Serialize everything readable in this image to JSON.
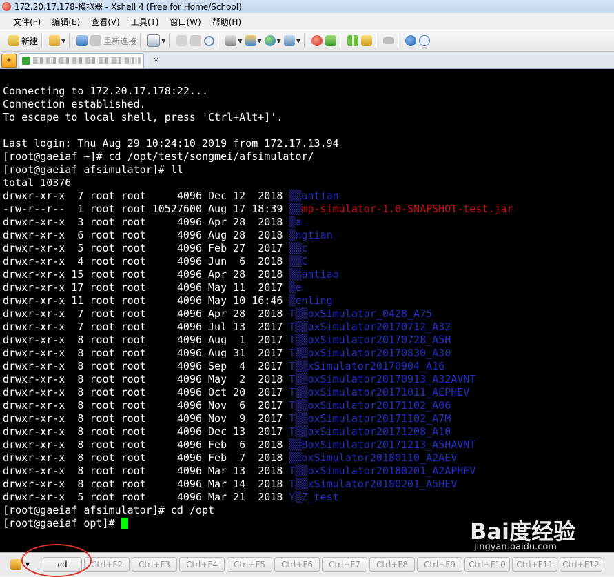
{
  "window": {
    "title": "172.20.17.178-模拟器 - Xshell 4 (Free for Home/School)"
  },
  "menu": [
    "文件(F)",
    "编辑(E)",
    "查看(V)",
    "工具(T)",
    "窗口(W)",
    "帮助(H)"
  ],
  "toolbar": {
    "new_label": "新建",
    "reconnect_label": "重新连接"
  },
  "tab": {
    "close": "×"
  },
  "terminal": {
    "lines": [
      {
        "parts": [
          {
            "t": ""
          }
        ]
      },
      {
        "parts": [
          {
            "t": "Connecting to 172.20.17.178:22..."
          }
        ]
      },
      {
        "parts": [
          {
            "t": "Connection established."
          }
        ]
      },
      {
        "parts": [
          {
            "t": "To escape to local shell, press 'Ctrl+Alt+]'."
          }
        ]
      },
      {
        "parts": [
          {
            "t": ""
          }
        ]
      },
      {
        "parts": [
          {
            "t": "Last login: Thu Aug 29 10:24:10 2019 from 172.17.13.94"
          }
        ]
      },
      {
        "parts": [
          {
            "t": "[root@gaeiaf ~]# cd /opt/test/songmei/afsimulator/"
          }
        ]
      },
      {
        "parts": [
          {
            "t": "[root@gaeiaf afsimulator]# ll"
          }
        ]
      },
      {
        "parts": [
          {
            "t": "total 10376"
          }
        ]
      },
      {
        "parts": [
          {
            "t": "drwxr-xr-x  7 root root     4096 Dec 12  2018 "
          },
          {
            "t": "▒▒",
            "c": "mask"
          },
          {
            "t": "antian",
            "c": "dir"
          }
        ]
      },
      {
        "parts": [
          {
            "t": "-rw-r--r--  1 root root 10527600 Aug 17 18:39 "
          },
          {
            "t": "▒▒",
            "c": "mask"
          },
          {
            "t": "mp-simulator-1.0-SNAPSHOT-test.jar",
            "c": "jar"
          }
        ]
      },
      {
        "parts": [
          {
            "t": "drwxr-xr-x  3 root root     4096 Apr 28  2018 "
          },
          {
            "t": "▒",
            "c": "mask"
          },
          {
            "t": "a",
            "c": "dir"
          }
        ]
      },
      {
        "parts": [
          {
            "t": "drwxr-xr-x  6 root root     4096 Aug 28  2018 "
          },
          {
            "t": "▒",
            "c": "mask"
          },
          {
            "t": "ngtian",
            "c": "dir"
          }
        ]
      },
      {
        "parts": [
          {
            "t": "drwxr-xr-x  5 root root     4096 Feb 27  2017 "
          },
          {
            "t": "▒▒",
            "c": "mask"
          },
          {
            "t": "c",
            "c": "dir"
          }
        ]
      },
      {
        "parts": [
          {
            "t": "drwxr-xr-x  4 root root     4096 Jun  6  2018 "
          },
          {
            "t": "▒▒",
            "c": "mask"
          },
          {
            "t": "C",
            "c": "dir"
          }
        ]
      },
      {
        "parts": [
          {
            "t": "drwxr-xr-x 15 root root     4096 Apr 28  2018 "
          },
          {
            "t": "▒▒",
            "c": "mask"
          },
          {
            "t": "antiao",
            "c": "dir"
          }
        ]
      },
      {
        "parts": [
          {
            "t": "drwxr-xr-x 17 root root     4096 May 11  2017 "
          },
          {
            "t": "▒",
            "c": "mask"
          },
          {
            "t": "e",
            "c": "dir"
          }
        ]
      },
      {
        "parts": [
          {
            "t": "drwxr-xr-x 11 root root     4096 May 10 16:46 "
          },
          {
            "t": "▒",
            "c": "mask"
          },
          {
            "t": "enling",
            "c": "dir"
          }
        ]
      },
      {
        "parts": [
          {
            "t": "drwxr-xr-x  7 root root     4096 Apr 28  2018 "
          },
          {
            "t": "T▒▒",
            "c": "mask"
          },
          {
            "t": "oxSimulator_0428_A75",
            "c": "dir"
          }
        ]
      },
      {
        "parts": [
          {
            "t": "drwxr-xr-x  7 root root     4096 Jul 13  2017 "
          },
          {
            "t": "T▒▒",
            "c": "mask"
          },
          {
            "t": "oxSimulator20170712_A32",
            "c": "dir"
          }
        ]
      },
      {
        "parts": [
          {
            "t": "drwxr-xr-x  8 root root     4096 Aug  1  2017 "
          },
          {
            "t": "T▒▒",
            "c": "mask"
          },
          {
            "t": "oxSimulator20170728_A5H",
            "c": "dir"
          }
        ]
      },
      {
        "parts": [
          {
            "t": "drwxr-xr-x  8 root root     4096 Aug 31  2017 "
          },
          {
            "t": "T▒▒",
            "c": "mask"
          },
          {
            "t": "oxSimulator20170830_A30",
            "c": "dir"
          }
        ]
      },
      {
        "parts": [
          {
            "t": "drwxr-xr-x  8 root root     4096 Sep  4  2017 "
          },
          {
            "t": "T▒▒",
            "c": "mask"
          },
          {
            "t": "xSimulator20170904_A16",
            "c": "dir"
          }
        ]
      },
      {
        "parts": [
          {
            "t": "drwxr-xr-x  8 root root     4096 May  2  2018 "
          },
          {
            "t": "T▒▒",
            "c": "mask"
          },
          {
            "t": "oxSimulator20170913_A32AVNT",
            "c": "dir"
          }
        ]
      },
      {
        "parts": [
          {
            "t": "drwxr-xr-x  8 root root     4096 Oct 20  2017 "
          },
          {
            "t": "T▒▒",
            "c": "mask"
          },
          {
            "t": "oxSimulator20171011_AEPHEV",
            "c": "dir"
          }
        ]
      },
      {
        "parts": [
          {
            "t": "drwxr-xr-x  8 root root     4096 Nov  6  2017 "
          },
          {
            "t": "T▒▒",
            "c": "mask"
          },
          {
            "t": "oxSimulator20171102_A06",
            "c": "dir"
          }
        ]
      },
      {
        "parts": [
          {
            "t": "drwxr-xr-x  8 root root     4096 Nov  9  2017 "
          },
          {
            "t": "T▒▒",
            "c": "mask"
          },
          {
            "t": "oxSimulator20171102_A7M",
            "c": "dir"
          }
        ]
      },
      {
        "parts": [
          {
            "t": "drwxr-xr-x  8 root root     4096 Dec 13  2017 "
          },
          {
            "t": "T▒▒",
            "c": "mask"
          },
          {
            "t": "oxSimulator20171208_A10",
            "c": "dir"
          }
        ]
      },
      {
        "parts": [
          {
            "t": "drwxr-xr-x  8 root root     4096 Feb  6  2018 "
          },
          {
            "t": "▒▒",
            "c": "mask"
          },
          {
            "t": "BoxSimulator20171213_A5HAVNT",
            "c": "dir"
          }
        ]
      },
      {
        "parts": [
          {
            "t": "drwxr-xr-x  8 root root     4096 Feb  7  2018 "
          },
          {
            "t": "▒▒",
            "c": "mask"
          },
          {
            "t": "oxSimulator20180110_A2AEV",
            "c": "dir"
          }
        ]
      },
      {
        "parts": [
          {
            "t": "drwxr-xr-x  8 root root     4096 Mar 13  2018 "
          },
          {
            "t": "T▒▒",
            "c": "mask"
          },
          {
            "t": "oxSimulator20180201_A2APHEV",
            "c": "dir"
          }
        ]
      },
      {
        "parts": [
          {
            "t": "drwxr-xr-x  8 root root     4096 Mar 14  2018 "
          },
          {
            "t": "T▒▒",
            "c": "mask"
          },
          {
            "t": "xSimulator20180201_A5HEV",
            "c": "dir"
          }
        ]
      },
      {
        "parts": [
          {
            "t": "drwxr-xr-x  5 root root     4096 Mar 21  2018 "
          },
          {
            "t": "Y▒",
            "c": "mask"
          },
          {
            "t": "Z_test",
            "c": "dir"
          }
        ]
      },
      {
        "parts": [
          {
            "t": "[root@gaeiaf afsimulator]# cd /opt"
          }
        ]
      },
      {
        "parts": [
          {
            "t": "[root@gaeiaf opt]# "
          }
        ],
        "cursor": true
      }
    ]
  },
  "quickbar": {
    "buttons": [
      {
        "label": "cd",
        "active": true
      },
      {
        "label": "Ctrl+F2"
      },
      {
        "label": "Ctrl+F3"
      },
      {
        "label": "Ctrl+F4"
      },
      {
        "label": "Ctrl+F5"
      },
      {
        "label": "Ctrl+F6"
      },
      {
        "label": "Ctrl+F7"
      },
      {
        "label": "Ctrl+F8"
      },
      {
        "label": "Ctrl+F9"
      },
      {
        "label": "Ctrl+F10"
      },
      {
        "label": "Ctrl+F11"
      },
      {
        "label": "Ctrl+F12"
      }
    ]
  },
  "watermark": {
    "brand": "Bai度经验",
    "url": "jingyan.baidu.com"
  },
  "colors": {
    "terminal_bg": "#000000",
    "dir": "#2030c8",
    "jar": "#cc1010",
    "cursor": "#00ff00",
    "highlight_circle": "#e0302a"
  }
}
